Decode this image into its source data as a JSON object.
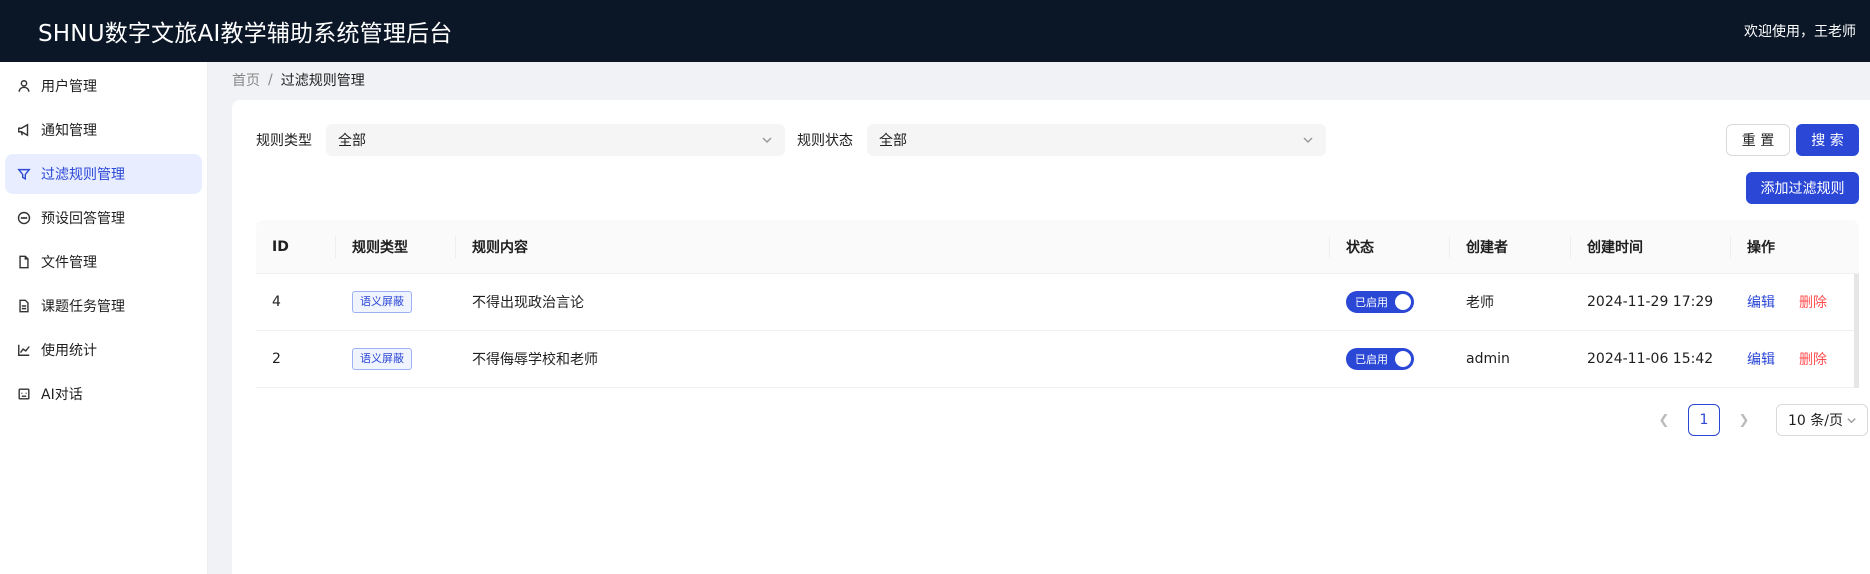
{
  "header": {
    "title": "SHNU数字文旅AI教学辅助系统管理后台",
    "welcome": "欢迎使用，王老师"
  },
  "sidebar": {
    "items": [
      {
        "label": "用户管理",
        "icon": "user-icon"
      },
      {
        "label": "通知管理",
        "icon": "megaphone-icon"
      },
      {
        "label": "过滤规则管理",
        "icon": "filter-icon",
        "active": true
      },
      {
        "label": "预设回答管理",
        "icon": "chat-icon"
      },
      {
        "label": "文件管理",
        "icon": "file-icon"
      },
      {
        "label": "课题任务管理",
        "icon": "task-file-icon"
      },
      {
        "label": "使用统计",
        "icon": "line-chart-icon"
      },
      {
        "label": "AI对话",
        "icon": "robot-icon"
      }
    ]
  },
  "breadcrumb": {
    "home": "首页",
    "separator": "/",
    "current": "过滤规则管理"
  },
  "filters": {
    "rule_type_label": "规则类型",
    "rule_type_value": "全部",
    "rule_status_label": "规则状态",
    "rule_status_value": "全部"
  },
  "buttons": {
    "reset": "重 置",
    "search": "搜 索",
    "add": "添加过滤规则"
  },
  "table": {
    "headers": {
      "id": "ID",
      "type": "规则类型",
      "content": "规则内容",
      "status": "状态",
      "creator": "创建者",
      "time": "创建时间",
      "op": "操作"
    },
    "rows": [
      {
        "id": "4",
        "type": "语义屏蔽",
        "content": "不得出现政治言论",
        "status": "已启用",
        "creator": "老师",
        "time": "2024-11-29 17:29",
        "edit": "编辑",
        "delete": "删除"
      },
      {
        "id": "2",
        "type": "语义屏蔽",
        "content": "不得侮辱学校和老师",
        "status": "已启用",
        "creator": "admin",
        "time": "2024-11-06 15:42",
        "edit": "编辑",
        "delete": "删除"
      }
    ]
  },
  "pagination": {
    "current": "1",
    "page_size": "10 条/页"
  },
  "colors": {
    "primary": "#2b47d6",
    "danger": "#ff4d4f",
    "header_bg": "#0b1727"
  }
}
